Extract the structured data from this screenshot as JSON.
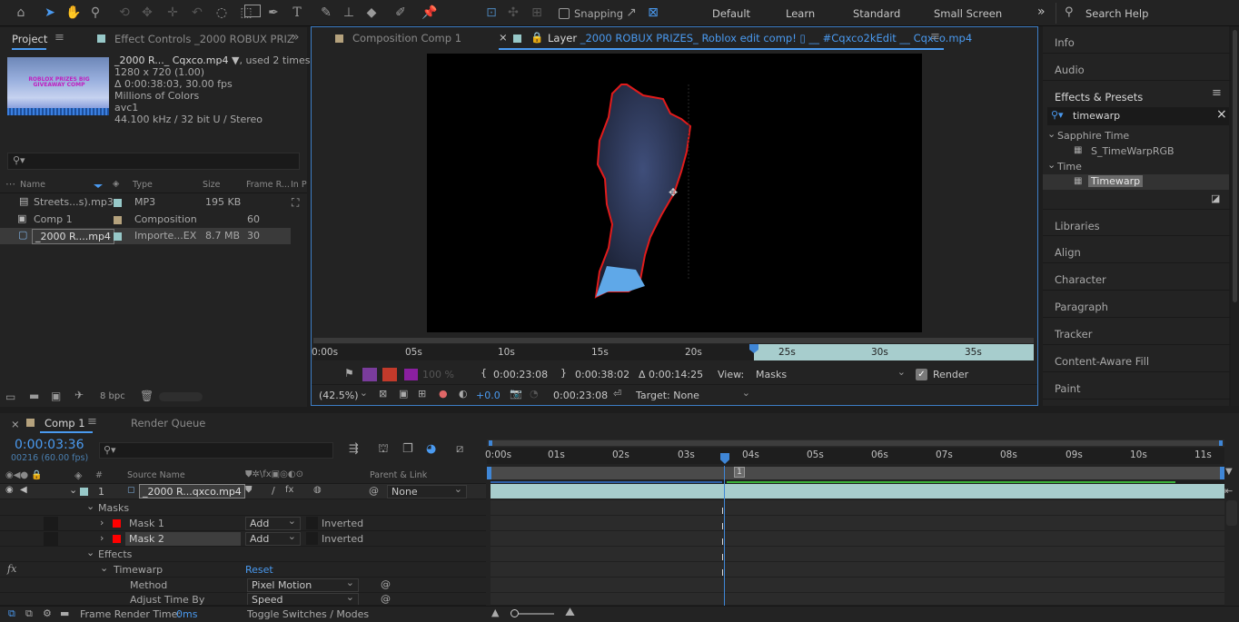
{
  "toolbar": {
    "snapping_label": "Snapping",
    "workspaces": [
      "Default",
      "Learn",
      "Standard",
      "Small Screen"
    ],
    "more": "»",
    "search_placeholder": "Search Help"
  },
  "project": {
    "tab": "Project",
    "effect_controls_tab": "Effect Controls _2000 ROBUX PRIZ",
    "overflow": "»",
    "thumb_text": "ROBLOX PRIZES BIG GIVEAWAY COMP",
    "file_name": "_2000 R..._ Cqxco.mp4",
    "used": ", used 2 times",
    "resolution": "1280 x 720 (1.00)",
    "duration": "Δ 0:00:38:03, 30.00 fps",
    "colors": "Millions of Colors",
    "codec": "avc1",
    "audio": "44.100 kHz / 32 bit U / Stereo",
    "search_placeholder": "",
    "columns": {
      "name": "Name",
      "type": "Type",
      "size": "Size",
      "frame_rate": "Frame R...",
      "in_point": "In P"
    },
    "items": [
      {
        "name": "Streets...s).mp3",
        "type": "MP3",
        "size": "195 KB",
        "fps": ""
      },
      {
        "name": "Comp 1",
        "type": "Composition",
        "size": "",
        "fps": "60"
      },
      {
        "name": "_2000 R....mp4",
        "type": "Importe...EX",
        "size": "8.7 MB",
        "fps": "30"
      }
    ],
    "bpc": "8 bpc"
  },
  "viewer": {
    "comp_tab": "Composition Comp 1",
    "layer_tab_prefix": "Layer",
    "layer_tab_name": "_2000 ROBUX PRIZES_ Roblox edit comp! ▯ __ #Cqxco2kEdit __ Cqxco.mp4",
    "ruler": [
      "0:00s",
      "05s",
      "10s",
      "15s",
      "20s",
      "25s",
      "30s",
      "35s"
    ],
    "opacity": "100 %",
    "in_time": "0:00:23:08",
    "out_time": "0:00:38:02",
    "dur_time": "Δ 0:00:14:25",
    "view_label": "View:",
    "view_value": "Masks",
    "render_label": "Render",
    "zoom": "(42.5%)",
    "exposure": "+0.0",
    "current_time": "0:00:23:08",
    "target": "Target: None"
  },
  "right": {
    "info": "Info",
    "audio": "Audio",
    "effects_presets": "Effects & Presets",
    "search_value": "timewarp",
    "tree": [
      {
        "group": "Sapphire Time",
        "item": "S_TimeWarpRGB"
      },
      {
        "group": "Time",
        "item": "Timewarp"
      }
    ],
    "panels": [
      "Libraries",
      "Align",
      "Character",
      "Paragraph",
      "Tracker",
      "Content-Aware Fill",
      "Paint"
    ]
  },
  "timeline": {
    "comp_tab": "Comp 1",
    "render_queue_tab": "Render Queue",
    "timecode": "0:00:03:36",
    "frame_info": "00216 (60.00 fps)",
    "search_placeholder": "",
    "col_num": "#",
    "col_source": "Source Name",
    "col_parent": "Parent & Link",
    "layer_num": "1",
    "layer_name": "_2000 R...qxco.mp4",
    "parent_value": "None",
    "masks_label": "Masks",
    "mask1": "Mask 1",
    "mask2": "Mask 2",
    "mask_mode": "Add",
    "inverted": "Inverted",
    "effects_label": "Effects",
    "timewarp_label": "Timewarp",
    "reset": "Reset",
    "method_label": "Method",
    "method_value": "Pixel Motion",
    "adjust_label": "Adjust Time By",
    "adjust_value": "Speed",
    "ruler": [
      "0:00s",
      "01s",
      "02s",
      "03s",
      "04s",
      "05s",
      "06s",
      "07s",
      "08s",
      "09s",
      "10s",
      "11s"
    ],
    "work_marker": "1",
    "frame_render_label": "Frame Render Time:",
    "frame_render_value": "0ms",
    "toggle_label": "Toggle Switches / Modes"
  },
  "colors": {
    "accent": "#4a9af0",
    "mask_red": "#ff0000",
    "layer_teal": "#97c8c8",
    "label_tan": "#b5a27d"
  }
}
